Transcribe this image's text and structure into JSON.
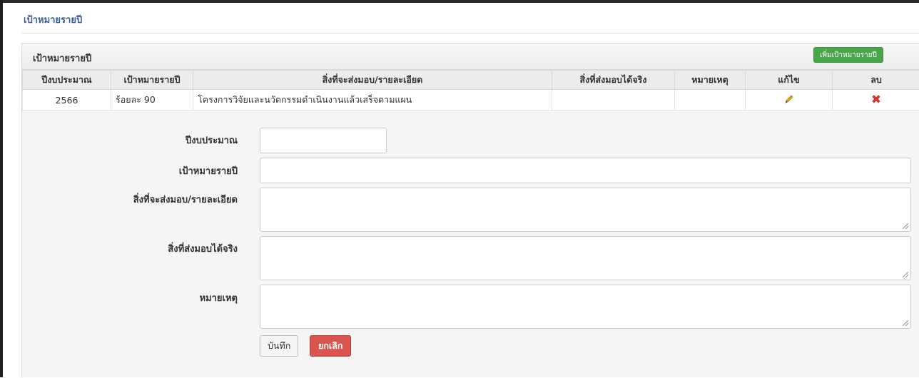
{
  "page": {
    "title": "เป้าหมายรายปี"
  },
  "panel": {
    "title": "เป้าหมายรายปี",
    "add_button": "เพิ่มเป้าหมายรายปี"
  },
  "table": {
    "headers": [
      "ปีงบประมาณ",
      "เป้าหมายรายปี",
      "สิ่งที่จะส่งมอบ/รายละเอียด",
      "สิ่งที่ส่งมอบได้จริง",
      "หมายเหตุ",
      "แก้ไข",
      "ลบ"
    ],
    "rows": [
      {
        "year": "2566",
        "target": "ร้อยละ 90",
        "deliverable": "โครงการวิจัยและนวัตกรรมดำเนินงานแล้วเสร็จตามแผน",
        "actual": "",
        "note": ""
      }
    ]
  },
  "form": {
    "year_label": "ปีงบประมาณ",
    "target_label": "เป้าหมายรายปี",
    "deliverable_label": "สิ่งที่จะส่งมอบ/รายละเอียด",
    "actual_label": "สิ่งที่ส่งมอบได้จริง",
    "note_label": "หมายเหตุ",
    "year_value": "",
    "target_value": "",
    "deliverable_value": "",
    "actual_value": "",
    "note_value": "",
    "save_label": "บันทึก",
    "cancel_label": "ยกเลิก"
  },
  "colors": {
    "title": "#3b5f97",
    "add_button": "#4aa54a",
    "cancel_button": "#d9534f",
    "edit_icon": "#f0a30a",
    "delete_icon": "#d9342b"
  },
  "icons": {
    "edit": "pencil-icon",
    "delete": "close-icon"
  }
}
